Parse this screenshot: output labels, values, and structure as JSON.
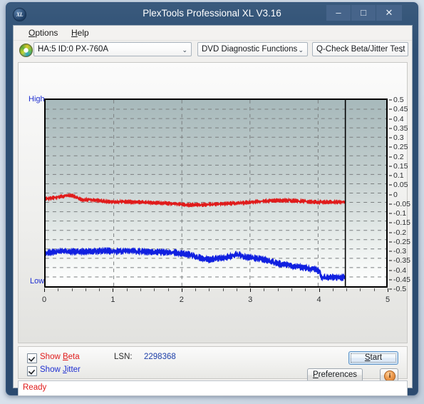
{
  "window": {
    "title": "PlexTools Professional XL V3.16",
    "app_icon": "XL",
    "minimize_label": "–",
    "maximize_label": "□",
    "close_label": "✕"
  },
  "menu": {
    "items": [
      {
        "label": "Options",
        "accel": "O"
      },
      {
        "label": "Help",
        "accel": "H"
      }
    ]
  },
  "toolbar": {
    "drive_icon": "disc-icon",
    "drive_select": {
      "value": "HA:5 ID:0  PX-760A",
      "arrow": "⌄"
    },
    "function_select": {
      "value": "DVD Diagnostic Functions",
      "arrow": "⌄"
    },
    "test_select": {
      "value": "Q-Check Beta/Jitter Test",
      "arrow": "⌄"
    }
  },
  "graph": {
    "high_label": "High",
    "low_label": "Low"
  },
  "controls": {
    "show_beta": {
      "label_pre": "Show ",
      "accel": "B",
      "label_post": "eta",
      "checked": true
    },
    "show_jitter": {
      "label_pre": "Show ",
      "accel": "J",
      "label_post": "itter",
      "checked": true
    },
    "lsn_label": "LSN:",
    "lsn_value": "2298368",
    "start_button": {
      "pre": "",
      "accel": "S",
      "post": "tart"
    },
    "preferences_button": {
      "pre": "",
      "accel": "P",
      "post": "references"
    },
    "info_button": "i"
  },
  "status": {
    "text": "Ready"
  },
  "chart_data": {
    "type": "line",
    "title": "Q-Check Beta/Jitter Test",
    "xlabel": "",
    "ylabel": "",
    "xlim": [
      0,
      5
    ],
    "ylim": [
      -0.5,
      0.5
    ],
    "grid": true,
    "x_ticks": [
      0,
      1,
      2,
      3,
      4,
      5
    ],
    "x_minor_step": 0.2,
    "y_ticks": [
      0.5,
      0.45,
      0.4,
      0.35,
      0.3,
      0.25,
      0.2,
      0.15,
      0.1,
      0.05,
      0,
      -0.05,
      -0.1,
      -0.15,
      -0.2,
      -0.25,
      -0.3,
      -0.35,
      -0.4,
      -0.45,
      -0.5
    ],
    "y_axis_top_label": "High",
    "y_axis_bottom_label": "Low",
    "data_end_x": 4.4,
    "legend_position": "below-left",
    "series": [
      {
        "name": "Beta",
        "color": "#e01b1b",
        "noise": 0.012,
        "x": [
          0.0,
          0.08,
          0.16,
          0.24,
          0.32,
          0.4,
          0.48,
          0.56,
          0.64,
          0.72,
          0.8,
          0.9,
          1.0,
          1.15,
          1.3,
          1.45,
          1.6,
          1.75,
          1.9,
          2.0,
          2.1,
          2.2,
          2.35,
          2.5,
          2.65,
          2.8,
          2.95,
          3.1,
          3.25,
          3.4,
          3.55,
          3.7,
          3.85,
          4.0,
          4.15,
          4.28,
          4.4
        ],
        "y": [
          -0.03,
          -0.028,
          -0.022,
          -0.018,
          -0.014,
          -0.012,
          -0.03,
          -0.036,
          -0.034,
          -0.038,
          -0.04,
          -0.046,
          -0.048,
          -0.046,
          -0.048,
          -0.05,
          -0.052,
          -0.054,
          -0.058,
          -0.062,
          -0.064,
          -0.064,
          -0.062,
          -0.06,
          -0.058,
          -0.054,
          -0.05,
          -0.046,
          -0.042,
          -0.04,
          -0.04,
          -0.042,
          -0.046,
          -0.048,
          -0.048,
          -0.048,
          -0.048
        ]
      },
      {
        "name": "Jitter",
        "color": "#1020e0",
        "noise": 0.02,
        "x": [
          0.0,
          0.1,
          0.25,
          0.4,
          0.55,
          0.7,
          0.85,
          1.0,
          1.2,
          1.4,
          1.6,
          1.8,
          2.0,
          2.1,
          2.2,
          2.3,
          2.4,
          2.5,
          2.6,
          2.7,
          2.78,
          2.85,
          2.95,
          3.05,
          3.15,
          3.25,
          3.35,
          3.45,
          3.55,
          3.65,
          3.75,
          3.85,
          3.95,
          4.02,
          4.05,
          4.1,
          4.2,
          4.3,
          4.4
        ],
        "y": [
          -0.32,
          -0.318,
          -0.312,
          -0.314,
          -0.314,
          -0.312,
          -0.31,
          -0.312,
          -0.312,
          -0.314,
          -0.316,
          -0.318,
          -0.322,
          -0.33,
          -0.34,
          -0.352,
          -0.358,
          -0.352,
          -0.348,
          -0.34,
          -0.33,
          -0.332,
          -0.344,
          -0.348,
          -0.352,
          -0.362,
          -0.372,
          -0.38,
          -0.386,
          -0.392,
          -0.398,
          -0.404,
          -0.41,
          -0.418,
          -0.452,
          -0.452,
          -0.452,
          -0.452,
          -0.452
        ]
      }
    ]
  }
}
